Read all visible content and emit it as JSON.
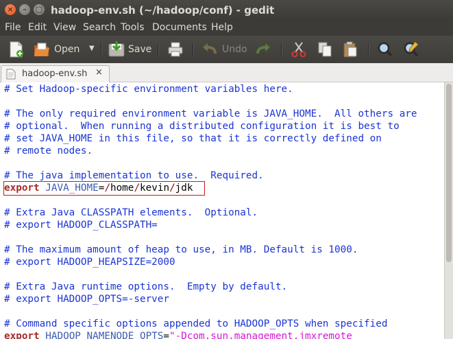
{
  "window": {
    "title": "hadoop-env.sh (~/hadoop/conf) - gedit",
    "close_glyph": "×",
    "min_glyph": "–",
    "max_glyph": "□"
  },
  "menu": [
    "File",
    "Edit",
    "View",
    "Search",
    "Tools",
    "Documents",
    "Help"
  ],
  "toolbar": {
    "open_label": "Open",
    "save_label": "Save",
    "undo_label": "Undo"
  },
  "tab": {
    "label": "hadoop-env.sh",
    "close_glyph": "×"
  },
  "editor": {
    "lines": [
      {
        "kind": "comment",
        "text": "# Set Hadoop-specific environment variables here."
      },
      {
        "kind": "blank",
        "text": ""
      },
      {
        "kind": "comment",
        "text": "# The only required environment variable is JAVA_HOME.  All others are"
      },
      {
        "kind": "comment",
        "text": "# optional.  When running a distributed configuration it is best to"
      },
      {
        "kind": "comment",
        "text": "# set JAVA_HOME in this file, so that it is correctly defined on"
      },
      {
        "kind": "comment",
        "text": "# remote nodes."
      },
      {
        "kind": "blank",
        "text": ""
      },
      {
        "kind": "comment",
        "text": "# The java implementation to use.  Required."
      },
      {
        "kind": "export",
        "keyword": "export",
        "var": "JAVA_HOME",
        "eq": "=",
        "value": "/home/kevin/jdk"
      },
      {
        "kind": "blank",
        "text": ""
      },
      {
        "kind": "comment",
        "text": "# Extra Java CLASSPATH elements.  Optional."
      },
      {
        "kind": "comment",
        "text": "# export HADOOP_CLASSPATH="
      },
      {
        "kind": "blank",
        "text": ""
      },
      {
        "kind": "comment",
        "text": "# The maximum amount of heap to use, in MB. Default is 1000."
      },
      {
        "kind": "comment",
        "text": "# export HADOOP_HEAPSIZE=2000"
      },
      {
        "kind": "blank",
        "text": ""
      },
      {
        "kind": "comment",
        "text": "# Extra Java runtime options.  Empty by default."
      },
      {
        "kind": "comment",
        "text": "# export HADOOP_OPTS=-server"
      },
      {
        "kind": "blank",
        "text": ""
      },
      {
        "kind": "comment",
        "text": "# Command specific options appended to HADOOP_OPTS when specified"
      },
      {
        "kind": "export2",
        "keyword": "export",
        "var": "HADOOP_NAMENODE_OPTS",
        "eq": "=",
        "value": "\"-Dcom.sun.management.jmxremote"
      }
    ]
  },
  "colors": {
    "comment": "#1a34d4",
    "keyword": "#a52a2a",
    "string": "#d418d4",
    "highlight_border": "#c81818"
  }
}
